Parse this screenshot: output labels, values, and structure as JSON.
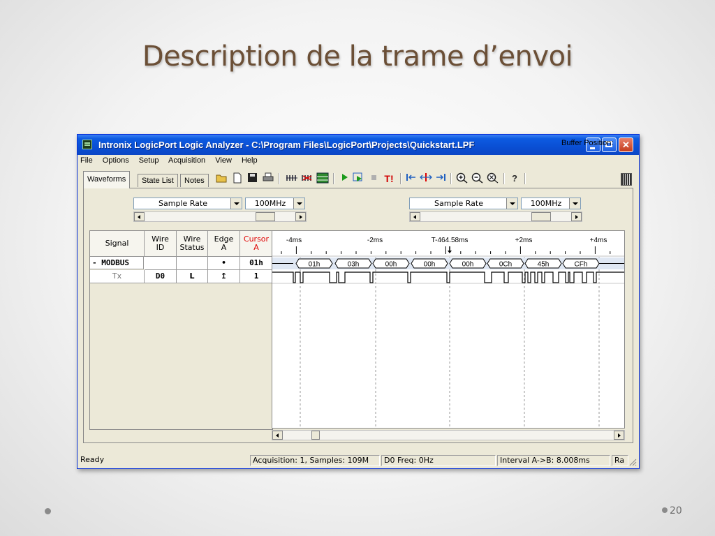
{
  "slide": {
    "title": "Description de la trame d’envoi",
    "page_number": "20"
  },
  "window": {
    "title": "Intronix LogicPort Logic Analyzer - C:\\Program Files\\LogicPort\\Projects\\Quickstart.LPF",
    "menu": [
      "File",
      "Options",
      "Setup",
      "Acquisition",
      "View",
      "Help"
    ],
    "tabs": [
      "Waveforms",
      "State List",
      "Notes"
    ],
    "active_tab": "Waveforms",
    "buffer_position_label": "Buffer Position:",
    "toolbar_icons": [
      "open-folder-icon",
      "new-file-icon",
      "save-icon",
      "print-icon",
      "channels-icon",
      "trigger-config-icon",
      "grid-icon",
      "run-icon",
      "single-run-icon",
      "stop-icon",
      "trigger-icon",
      "cursor-left-icon",
      "cursor-center-icon",
      "cursor-right-icon",
      "zoom-in-icon",
      "zoom-out-icon",
      "zoom-fit-icon",
      "help-icon"
    ],
    "trigger_label": "T!",
    "controls_left": {
      "rate_label": "Sample Rate",
      "rate_value": "100MHz"
    },
    "controls_right": {
      "rate_label": "Sample Rate",
      "rate_value": "100MHz"
    },
    "signal_table": {
      "headers": [
        "Signal",
        "Wire ID",
        "Wire Status",
        "Edge A",
        "Cursor A"
      ],
      "header_lines": [
        [
          "Signal"
        ],
        [
          "Wire",
          "ID"
        ],
        [
          "Wire",
          "Status"
        ],
        [
          "Edge",
          "A"
        ],
        [
          "Cursor",
          "A"
        ]
      ],
      "cursor_color": "#e00000",
      "rows": [
        {
          "signal": "- MODBUS",
          "wire_id": "",
          "wire_status": "",
          "edge": "•",
          "cursor": "01h"
        },
        {
          "signal": "Tx",
          "wire_id": "D0",
          "wire_status": "L",
          "edge": "↥",
          "cursor": "1"
        }
      ]
    },
    "time_axis": {
      "labels": [
        "-4ms",
        "-2ms",
        "T-464.58ms",
        "+2ms",
        "+4ms"
      ]
    },
    "bus_values": [
      "01h",
      "03h",
      "00h",
      "00h",
      "00h",
      "0Ch",
      "45h",
      "CFh"
    ],
    "status": {
      "ready": "Ready",
      "acquisition": "Acquisition: 1, Samples: 109M",
      "freq": "D0 Freq: 0Hz",
      "interval": "Interval A->B: 8.008ms",
      "extra": "Ra"
    }
  }
}
